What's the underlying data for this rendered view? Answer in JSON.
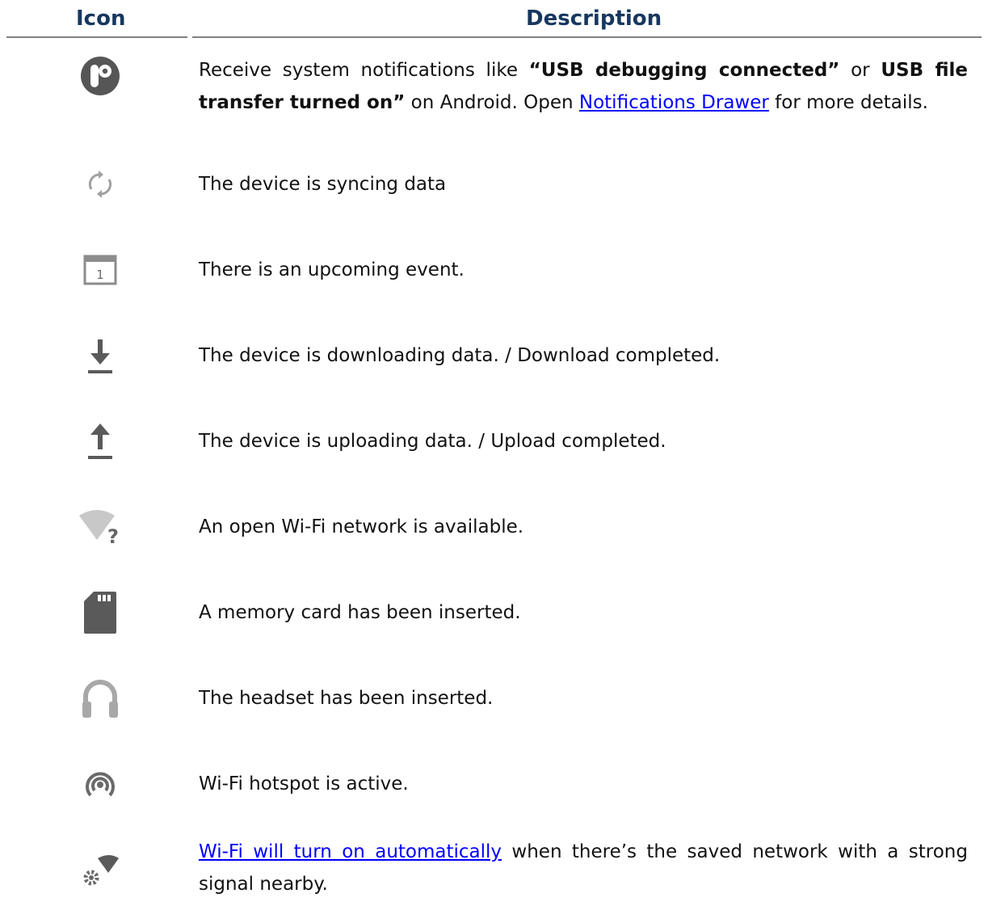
{
  "header": {
    "icon_col": "Icon",
    "desc_col": "Description"
  },
  "colors": {
    "header_text": "#17375e",
    "icon_gray": "#8c8c8c",
    "link": "#0000ff",
    "rule": "#7f7f7f"
  },
  "rows": [
    {
      "icon": "notification-app-icon",
      "desc": {
        "p1": "Receive system notifications like ",
        "b1": "“USB debugging connected”",
        "p2": " or ",
        "b2": "USB file transfer turned on”",
        "p3": " on Android. Open ",
        "link": "Notifications Drawer",
        "p4": " for more details."
      }
    },
    {
      "icon": "sync-icon",
      "text": "The device is syncing data"
    },
    {
      "icon": "calendar-icon",
      "calendar_day": "1",
      "text": "There is an upcoming event."
    },
    {
      "icon": "download-icon",
      "text": "The device is downloading data. / Download completed."
    },
    {
      "icon": "upload-icon",
      "text": "The device is uploading data. / Upload completed."
    },
    {
      "icon": "open-wifi-icon",
      "glyph": "?",
      "text": "An open Wi-Fi network is available."
    },
    {
      "icon": "sd-card-icon",
      "text": "A memory card has been inserted."
    },
    {
      "icon": "headset-icon",
      "text": "The headset has been inserted."
    },
    {
      "icon": "hotspot-icon",
      "text": "Wi-Fi hotspot is active."
    },
    {
      "icon": "wifi-auto-on-icon",
      "desc": {
        "link": "Wi-Fi will turn on automatically",
        "p1": " when there’s the saved network with a strong signal nearby."
      }
    }
  ]
}
